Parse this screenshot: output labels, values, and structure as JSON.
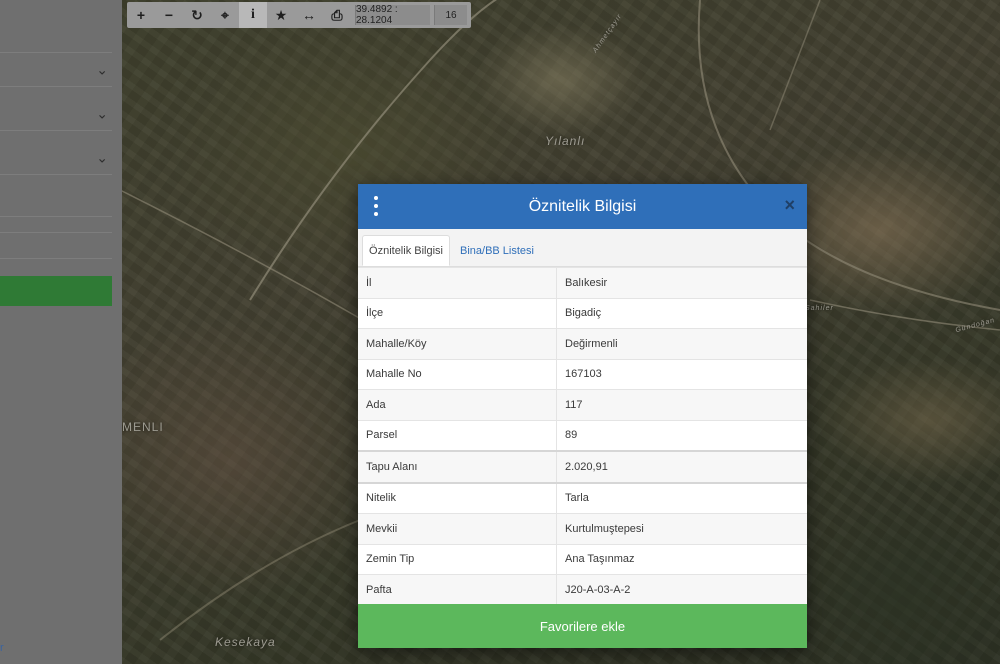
{
  "map": {
    "place_labels": [
      "Yılanlı",
      "MENLI",
      "Kesekaya"
    ],
    "road_labels": [
      "Ahmetçayır",
      "Sahiler",
      "Gündoğan"
    ]
  },
  "sidebar": {
    "link_text": "r"
  },
  "toolbar": {
    "buttons": [
      {
        "icon": "zoom-in-icon",
        "glyph": "+"
      },
      {
        "icon": "zoom-out-icon",
        "glyph": "−"
      },
      {
        "icon": "refresh-icon",
        "glyph": "↻"
      },
      {
        "icon": "locate-icon",
        "glyph": "⌖"
      },
      {
        "icon": "info-icon",
        "glyph": "i"
      },
      {
        "icon": "star-icon",
        "glyph": "★"
      },
      {
        "icon": "measure-icon",
        "glyph": "↔"
      },
      {
        "icon": "print-icon",
        "glyph": "⎙"
      }
    ],
    "coordinates": "39.4892 : 28.1204",
    "zoom": "16"
  },
  "modal": {
    "title": "Öznitelik Bilgisi",
    "close_glyph": "×",
    "tabs": [
      "Öznitelik Bilgisi",
      "Bina/BB Listesi"
    ],
    "rows": [
      {
        "key": "İl",
        "value": "Balıkesir"
      },
      {
        "key": "İlçe",
        "value": "Bigadiç"
      },
      {
        "key": "Mahalle/Köy",
        "value": "Değirmenli"
      },
      {
        "key": "Mahalle No",
        "value": "167103"
      },
      {
        "key": "Ada",
        "value": "117"
      },
      {
        "key": "Parsel",
        "value": "89"
      },
      {
        "key": "Tapu Alanı",
        "value": "2.020,91"
      },
      {
        "key": "Nitelik",
        "value": "Tarla"
      },
      {
        "key": "Mevkii",
        "value": "Kurtulmuştepesi"
      },
      {
        "key": "Zemin Tip",
        "value": "Ana Taşınmaz"
      },
      {
        "key": "Pafta",
        "value": "J20-A-03-A-2"
      }
    ],
    "favorite_button": "Favorilere ekle"
  },
  "colors": {
    "header_blue": "#2f6fb9",
    "button_green": "#5cb85c",
    "sidebar_green": "#2f7a35"
  }
}
